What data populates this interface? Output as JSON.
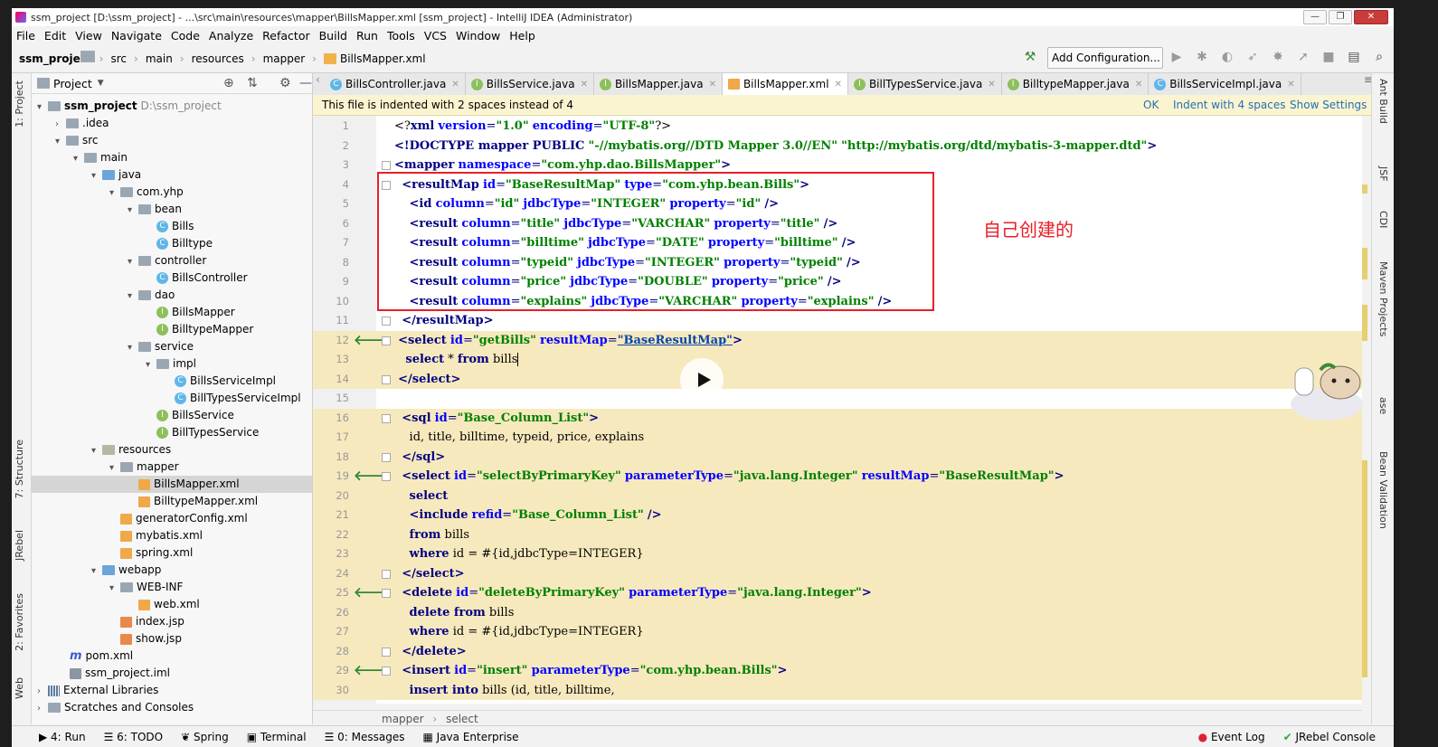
{
  "window": {
    "title": "ssm_project [D:\\ssm_project] - ...\\src\\main\\resources\\mapper\\BillsMapper.xml [ssm_project] - IntelliJ IDEA (Administrator)"
  },
  "menu": [
    "File",
    "Edit",
    "View",
    "Navigate",
    "Code",
    "Analyze",
    "Refactor",
    "Build",
    "Run",
    "Tools",
    "VCS",
    "Window",
    "Help"
  ],
  "navbar": {
    "crumbs": [
      "ssm_project",
      "src",
      "main",
      "resources",
      "mapper",
      "BillsMapper.xml"
    ],
    "add_config": "Add Configuration..."
  },
  "left_stripe": {
    "project": "1: Project",
    "structure": "7: Structure",
    "jrebel": "JRebel",
    "favorites": "2: Favorites",
    "web": "Web"
  },
  "project_panel": {
    "title": "Project",
    "tree": [
      {
        "label": "ssm_project",
        "extra": "D:\\ssm_project",
        "bold": true
      },
      {
        "label": ".idea"
      },
      {
        "label": "src"
      },
      {
        "label": "main"
      },
      {
        "label": "java"
      },
      {
        "label": "com.yhp"
      },
      {
        "label": "bean"
      },
      {
        "label": "Bills"
      },
      {
        "label": "Billtype"
      },
      {
        "label": "controller"
      },
      {
        "label": "BillsController"
      },
      {
        "label": "dao"
      },
      {
        "label": "BillsMapper"
      },
      {
        "label": "BilltypeMapper"
      },
      {
        "label": "service"
      },
      {
        "label": "impl"
      },
      {
        "label": "BillsServiceImpl"
      },
      {
        "label": "BillTypesServiceImpl"
      },
      {
        "label": "BillsService"
      },
      {
        "label": "BillTypesService"
      },
      {
        "label": "resources"
      },
      {
        "label": "mapper"
      },
      {
        "label": "BillsMapper.xml"
      },
      {
        "label": "BilltypeMapper.xml"
      },
      {
        "label": "generatorConfig.xml"
      },
      {
        "label": "mybatis.xml"
      },
      {
        "label": "spring.xml"
      },
      {
        "label": "webapp"
      },
      {
        "label": "WEB-INF"
      },
      {
        "label": "web.xml"
      },
      {
        "label": "index.jsp"
      },
      {
        "label": "show.jsp"
      },
      {
        "label": "pom.xml"
      },
      {
        "label": "ssm_project.iml"
      },
      {
        "label": "External Libraries"
      },
      {
        "label": "Scratches and Consoles"
      }
    ]
  },
  "tabs": [
    "BillsController.java",
    "BillsService.java",
    "BillsMapper.java",
    "BillsMapper.xml",
    "BillTypesService.java",
    "BilltypeMapper.java",
    "BillsServiceImpl.java"
  ],
  "banner": {
    "message": "This file is indented with 2 spaces instead of 4",
    "ok": "OK",
    "indent": "Indent with 4 spaces",
    "settings": "Show Settings"
  },
  "code_lines": [
    "<?xml version=\"1.0\" encoding=\"UTF-8\"?>",
    "<!DOCTYPE mapper PUBLIC \"-//mybatis.org//DTD Mapper 3.0//EN\" \"http://mybatis.org/dtd/mybatis-3-mapper.dtd\">",
    "<mapper namespace=\"com.yhp.dao.BillsMapper\">",
    "  <resultMap id=\"BaseResultMap\" type=\"com.yhp.bean.Bills\">",
    "    <id column=\"id\" jdbcType=\"INTEGER\" property=\"id\" />",
    "    <result column=\"title\" jdbcType=\"VARCHAR\" property=\"title\" />",
    "    <result column=\"billtime\" jdbcType=\"DATE\" property=\"billtime\" />",
    "    <result column=\"typeid\" jdbcType=\"INTEGER\" property=\"typeid\" />",
    "    <result column=\"price\" jdbcType=\"DOUBLE\" property=\"price\" />",
    "    <result column=\"explains\" jdbcType=\"VARCHAR\" property=\"explains\" />",
    "  </resultMap>",
    " <select id=\"getBills\" resultMap=\"BaseResultMap\">",
    "   select * from bills",
    " </select>",
    "",
    "  <sql id=\"Base_Column_List\">",
    "    id, title, billtime, typeid, price, explains",
    "  </sql>",
    "  <select id=\"selectByPrimaryKey\" parameterType=\"java.lang.Integer\" resultMap=\"BaseResultMap\">",
    "    select",
    "    <include refid=\"Base_Column_List\" />",
    "    from bills",
    "    where id = #{id,jdbcType=INTEGER}",
    "  </select>",
    "  <delete id=\"deleteByPrimaryKey\" parameterType=\"java.lang.Integer\">",
    "    delete from bills",
    "    where id = #{id,jdbcType=INTEGER}",
    "  </delete>",
    "  <insert id=\"insert\" parameterType=\"com.yhp.bean.Bills\">",
    "    insert into bills (id, title, billtime,"
  ],
  "annotation": "自己创建的",
  "breadcrumb": [
    "mapper",
    "select"
  ],
  "right_stripe": {
    "ant": "Ant Build",
    "jsf": "JSF",
    "cdi": "CDI",
    "maven": "Maven Projects",
    "db": "ase",
    "bean": "Bean Validation"
  },
  "bottom": [
    "4: Run",
    "6: TODO",
    "Spring",
    "Terminal",
    "0: Messages",
    "Java Enterprise",
    "Event Log",
    "JRebel Console"
  ],
  "colors": {
    "highlight": "#f7e9be",
    "annotation": "#e81f28",
    "link": "#2470b3"
  }
}
